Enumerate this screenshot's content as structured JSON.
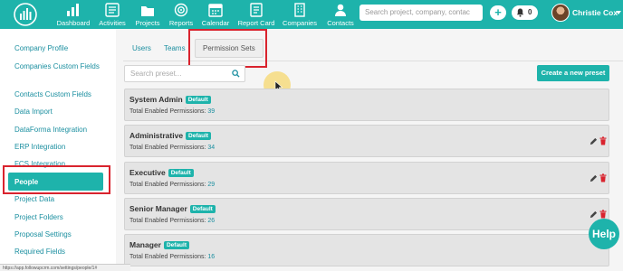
{
  "topnav": {
    "items": [
      {
        "label": "Dashboard",
        "icon": "dashboard-icon"
      },
      {
        "label": "Activities",
        "icon": "activities-icon"
      },
      {
        "label": "Projects",
        "icon": "projects-icon"
      },
      {
        "label": "Reports",
        "icon": "reports-icon"
      },
      {
        "label": "Calendar",
        "icon": "calendar-icon"
      },
      {
        "label": "Report Card",
        "icon": "report-card-icon"
      },
      {
        "label": "Companies",
        "icon": "companies-icon"
      },
      {
        "label": "Contacts",
        "icon": "contacts-icon"
      }
    ],
    "search_placeholder": "Search project, company, contac",
    "add_label": "+",
    "notification_count": "0",
    "user_name": "Christie Cox"
  },
  "sidebar": {
    "items": [
      {
        "label": "Company Profile"
      },
      {
        "label": "Companies Custom Fields"
      },
      {
        "label": "Contacts Custom Fields"
      },
      {
        "label": "Data Import"
      },
      {
        "label": "DataForma Integration"
      },
      {
        "label": "ERP Integration"
      },
      {
        "label": "FCS Integration"
      },
      {
        "label": "People"
      },
      {
        "label": "Project Data"
      },
      {
        "label": "Project Folders"
      },
      {
        "label": "Proposal Settings"
      },
      {
        "label": "Required Fields"
      }
    ],
    "active": "People"
  },
  "tabs": [
    {
      "label": "Users"
    },
    {
      "label": "Teams"
    },
    {
      "label": "Permission Sets"
    }
  ],
  "search_preset_placeholder": "Search preset...",
  "create_button_label": "Create a new preset",
  "permission_label": "Total Enabled Permissions:",
  "badge_label": "Default",
  "presets": [
    {
      "name": "System Admin",
      "count": "39"
    },
    {
      "name": "Administrative",
      "count": "34"
    },
    {
      "name": "Executive",
      "count": "29"
    },
    {
      "name": "Senior Manager",
      "count": "26"
    },
    {
      "name": "Manager",
      "count": "16"
    }
  ],
  "help_label": "Help",
  "status_url": "https://app.followupcrm.com/settings/people/1#",
  "colors": {
    "brand": "#1eb3ab",
    "link": "#1b8fa0",
    "highlight": "#d9232e",
    "delete": "#d9232e"
  }
}
